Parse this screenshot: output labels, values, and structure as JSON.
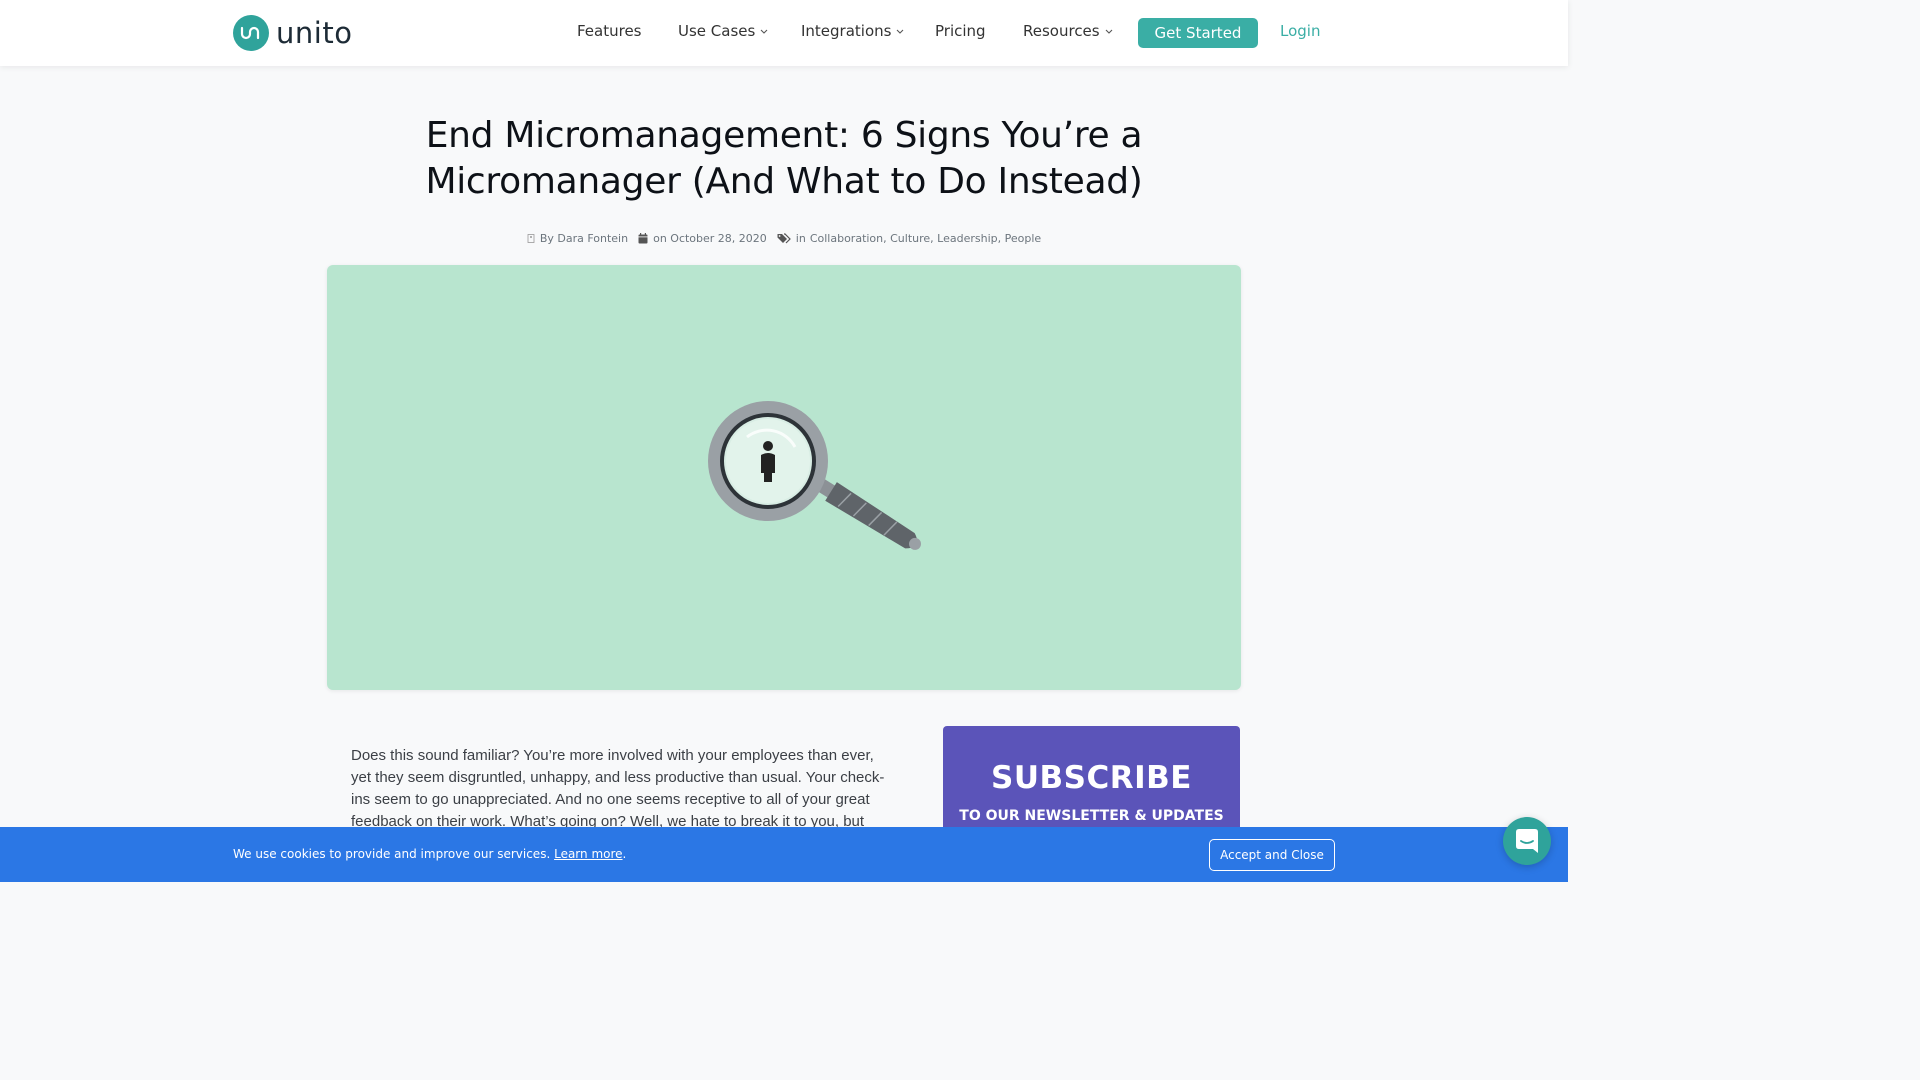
{
  "brand": {
    "name": "unito",
    "accent": "#3aaea5",
    "logo_icon": "unito-logo-icon"
  },
  "nav": {
    "features": "Features",
    "use_cases": "Use Cases",
    "integrations": "Integrations",
    "pricing": "Pricing",
    "resources": "Resources",
    "get_started": "Get Started",
    "login": "Login"
  },
  "article": {
    "title": "End Micromanagement: 6 Signs You’re a Micromanager (And What to Do Instead)",
    "author": "By Dara Fontein",
    "date": "on October 28, 2020",
    "categories_prefix": "in",
    "categories": "Collaboration, Culture, Leadership, People",
    "hero_image": "magnifying-glass-person-illustration",
    "hero_bg": "#b8e5cf",
    "intro": "Does this sound familiar? You’re more involved with your employees than ever, yet they seem disgruntled, unhappy, and less productive than usual. Your check-ins seem to go unappreciated. And no one seems receptive to all of your great feedback on their work. What’s going on? Well, we hate to break it to you, but you"
  },
  "subscribe": {
    "heading": "SUBSCRIBE",
    "subheading": "TO OUR NEWSLETTER & UPDATES",
    "bg": "#5b54b9"
  },
  "cookie": {
    "message": "We use cookies to provide and improve our services.",
    "learn_more": "Learn more",
    "period": ".",
    "accept": "Accept and Close",
    "bg": "#2b77e5"
  },
  "chat": {
    "icon": "chat-bubble-icon"
  }
}
